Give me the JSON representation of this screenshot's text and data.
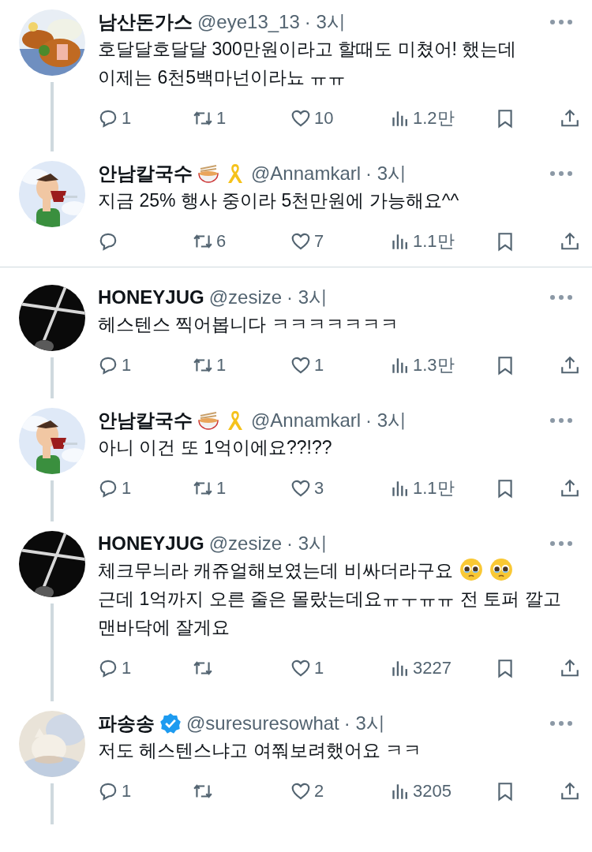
{
  "tweets": [
    {
      "name": "남산돈가스",
      "handle": "@eye13_13",
      "time": "· 3시",
      "connected": true,
      "divider_after": false,
      "avatar": {
        "kind": "picture"
      },
      "body": [
        {
          "kind": "text",
          "text": "호달달호달달 300만원이라고 할때도 미쳤어! 했는데 이제는 6천5백마넌이라뇨 ㅠㅠ"
        }
      ],
      "stats": {
        "replies": "1",
        "retweets": "1",
        "likes": "10",
        "views": "1.2만"
      }
    },
    {
      "name": "안남칼국수",
      "badges": [
        {
          "kind": "noodle"
        },
        {
          "kind": "ribbon"
        }
      ],
      "handle": "@Annamkarl",
      "time": "· 3시",
      "connected": false,
      "divider_after": true,
      "avatar": {
        "kind": "picture"
      },
      "body": [
        {
          "kind": "text",
          "text": "지금 25% 행사 중이라 5천만원에 가능해요^^"
        }
      ],
      "stats": {
        "retweets": "6",
        "likes": "7",
        "views": "1.1만"
      }
    },
    {
      "name": "HONEYJUG",
      "handle": "@zesize",
      "time": "· 3시",
      "connected": true,
      "divider_after": false,
      "avatar": {
        "kind": "picture"
      },
      "body": [
        {
          "kind": "text",
          "text": "헤스텐스 찍어봅니다 ㅋㅋㅋㅋㅋㅋㅋ"
        }
      ],
      "stats": {
        "replies": "1",
        "retweets": "1",
        "likes": "1",
        "views": "1.3만"
      }
    },
    {
      "name": "안남칼국수",
      "badges": [
        {
          "kind": "noodle"
        },
        {
          "kind": "ribbon"
        }
      ],
      "handle": "@Annamkarl",
      "time": "· 3시",
      "connected": true,
      "divider_after": false,
      "avatar": {
        "kind": "picture"
      },
      "body": [
        {
          "kind": "text",
          "text": "아니 이건 또 1억이에요??!??"
        }
      ],
      "stats": {
        "replies": "1",
        "retweets": "1",
        "likes": "3",
        "views": "1.1만"
      }
    },
    {
      "name": "HONEYJUG",
      "handle": "@zesize",
      "time": "· 3시",
      "connected": true,
      "divider_after": false,
      "avatar": {
        "kind": "picture"
      },
      "body": [
        {
          "kind": "text",
          "text": "체크무늬라 캐쥬얼해보였는데 비싸더라구요"
        },
        {
          "kind": "emoji"
        },
        {
          "kind": "emoji"
        },
        {
          "kind": "text",
          "text": "근데 1억까지 오른 줄은 몰랐는데요ㅠㅜㅠㅠ 전 토퍼 깔고 맨바닥에 잘게요"
        }
      ],
      "stats": {
        "replies": "1",
        "likes": "1",
        "views": "3227"
      }
    },
    {
      "name": "파송송",
      "badges": [
        {
          "kind": "verified"
        }
      ],
      "handle": "@suresuresowhat",
      "time": "· 3시",
      "connected": true,
      "divider_after": false,
      "avatar": {
        "kind": "picture"
      },
      "body": [
        {
          "kind": "text",
          "text": "저도 헤스텐스냐고 여쭤보려했어요 ㅋㅋ"
        }
      ],
      "stats": {
        "replies": "1",
        "likes": "2",
        "views": "3205"
      }
    }
  ]
}
